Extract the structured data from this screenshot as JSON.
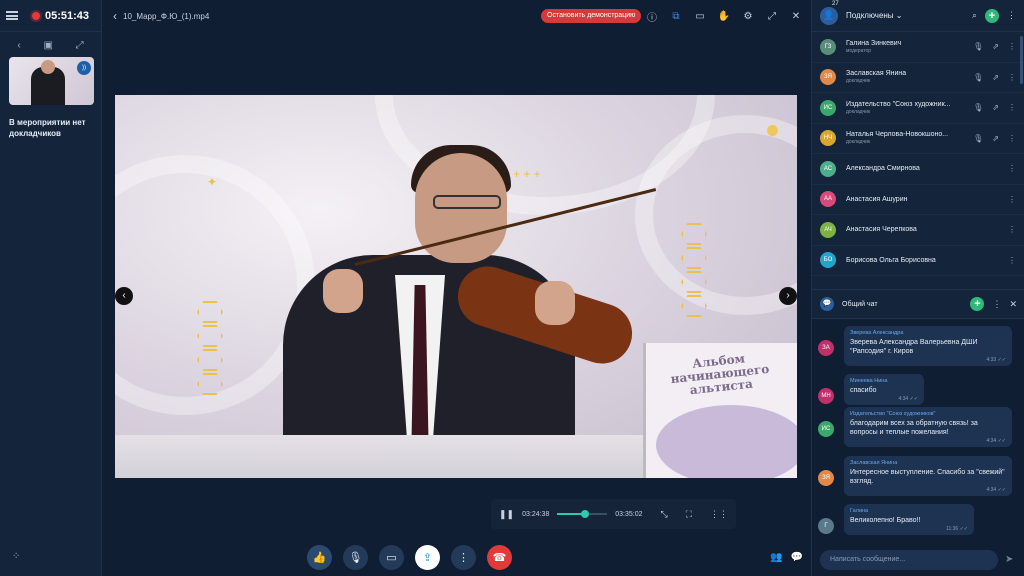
{
  "left_rail": {
    "timer": "05:51:43",
    "no_speakers": "В мероприятии нет докладчиков"
  },
  "topbar": {
    "file_name": "10_Марр_Ф.Ю_(1).mp4",
    "stop_demo": "Остановить демонстрацию"
  },
  "video": {
    "book_title": "Альбом начинающего альтиста"
  },
  "player": {
    "current": "03:24:38",
    "total": "03:35:02",
    "progress": 0.55
  },
  "participants": {
    "count": "27",
    "title": "Подключены",
    "items": [
      {
        "initials": "ГЗ",
        "name": "Галина Зинкевич",
        "role": "модератор",
        "color": "#5a8c7a"
      },
      {
        "initials": "ЗЯ",
        "name": "Заславская Янина",
        "role": "докладчик",
        "color": "#e0894a"
      },
      {
        "initials": "ИС",
        "name": "Издательство \"Союз художник...",
        "role": "докладчик",
        "color": "#3aa86a"
      },
      {
        "initials": "НЧ",
        "name": "Наталья Черлова-Новокшоно...",
        "role": "докладчик",
        "color": "#d9a630"
      },
      {
        "initials": "АС",
        "name": "Александра Смирнова",
        "role": "",
        "color": "#4caf8a"
      },
      {
        "initials": "АА",
        "name": "Анастасия Ашурин",
        "role": "",
        "color": "#d84a7a"
      },
      {
        "initials": "АЧ",
        "name": "Анастасия Черепкова",
        "role": "",
        "color": "#7cb342"
      },
      {
        "initials": "БО",
        "name": "Борисова Ольга Борисовна",
        "role": "",
        "color": "#1fa6c9"
      }
    ]
  },
  "chat": {
    "title": "Общий чат",
    "input_placeholder": "Написать сообщение...",
    "messages": [
      {
        "initials": "ЗА",
        "author": "Зверева Александра",
        "text": "Зверева Александра Валерьевна ДШИ \"Рапсодия\" г. Киров",
        "time": "4:33",
        "color": "#c0306a"
      },
      {
        "initials": "МН",
        "author": "Минеева Нина",
        "text": "спасибо",
        "time": "4:34",
        "color": "#c0306a"
      },
      {
        "initials": "ИС",
        "author": "Издательство \"Союз художников\"",
        "text": "благодарим всех за обратную связь! за вопросы и теплые пожелания!",
        "time": "4:34",
        "color": "#3aa86a"
      },
      {
        "initials": "ЗЯ",
        "author": "Заславская Янина",
        "text": "Интересное выступление. Спасибо за \"свежий\" взгляд.",
        "time": "4:34",
        "color": "#e0894a"
      },
      {
        "initials": "Г",
        "author": "Галина",
        "text": "Великолепно! Браво!!",
        "time": "11:36",
        "color": "#5a7a8c"
      }
    ]
  }
}
